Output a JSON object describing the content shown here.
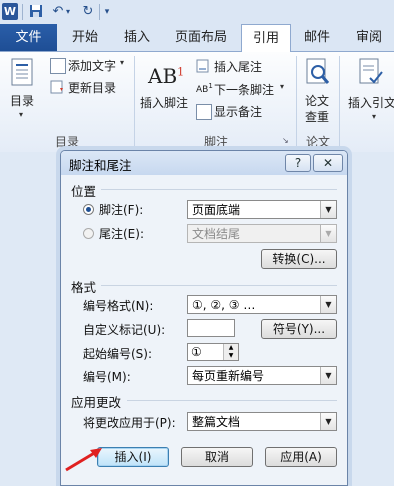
{
  "app": {
    "logo_letter": "W"
  },
  "tabs": [
    "文件",
    "开始",
    "插入",
    "页面布局",
    "引用",
    "邮件",
    "审阅"
  ],
  "ribbon": {
    "toc": {
      "label": "目录",
      "add_text": "添加文字",
      "update_toc": "更新目录",
      "group": "目录"
    },
    "footnotes": {
      "insert_footnote": "插入脚注",
      "insert_endnote": "插入尾注",
      "next_footnote": "下一条脚注",
      "show_notes": "显示备注",
      "group": "脚注",
      "ab_glyph": "AB",
      "ab_superscript": "1"
    },
    "research": {
      "label_line1": "论文",
      "label_line2": "查重",
      "group": "论文"
    },
    "citations": {
      "label": "插入引文"
    }
  },
  "dialog": {
    "title": "脚注和尾注",
    "help": "?",
    "close": "✕",
    "location": {
      "heading": "位置",
      "footnote_label": "脚注(F):",
      "footnote_value": "页面底端",
      "endnote_label": "尾注(E):",
      "endnote_value": "文档结尾",
      "convert_button": "转换(C)..."
    },
    "format": {
      "heading": "格式",
      "number_format_label": "编号格式(N):",
      "number_format_value": "①, ②, ③ …",
      "custom_mark_label": "自定义标记(U):",
      "custom_mark_value": "",
      "symbol_button": "符号(Y)...",
      "start_at_label": "起始编号(S):",
      "start_at_value": "①",
      "numbering_label": "编号(M):",
      "numbering_value": "每页重新编号"
    },
    "apply": {
      "heading": "应用更改",
      "apply_to_label": "将更改应用于(P):",
      "apply_to_value": "整篇文档"
    },
    "buttons": {
      "insert": "插入(I)",
      "cancel": "取消",
      "apply": "应用(A)"
    }
  },
  "annotation": {
    "arrow_color": "#e02020"
  }
}
